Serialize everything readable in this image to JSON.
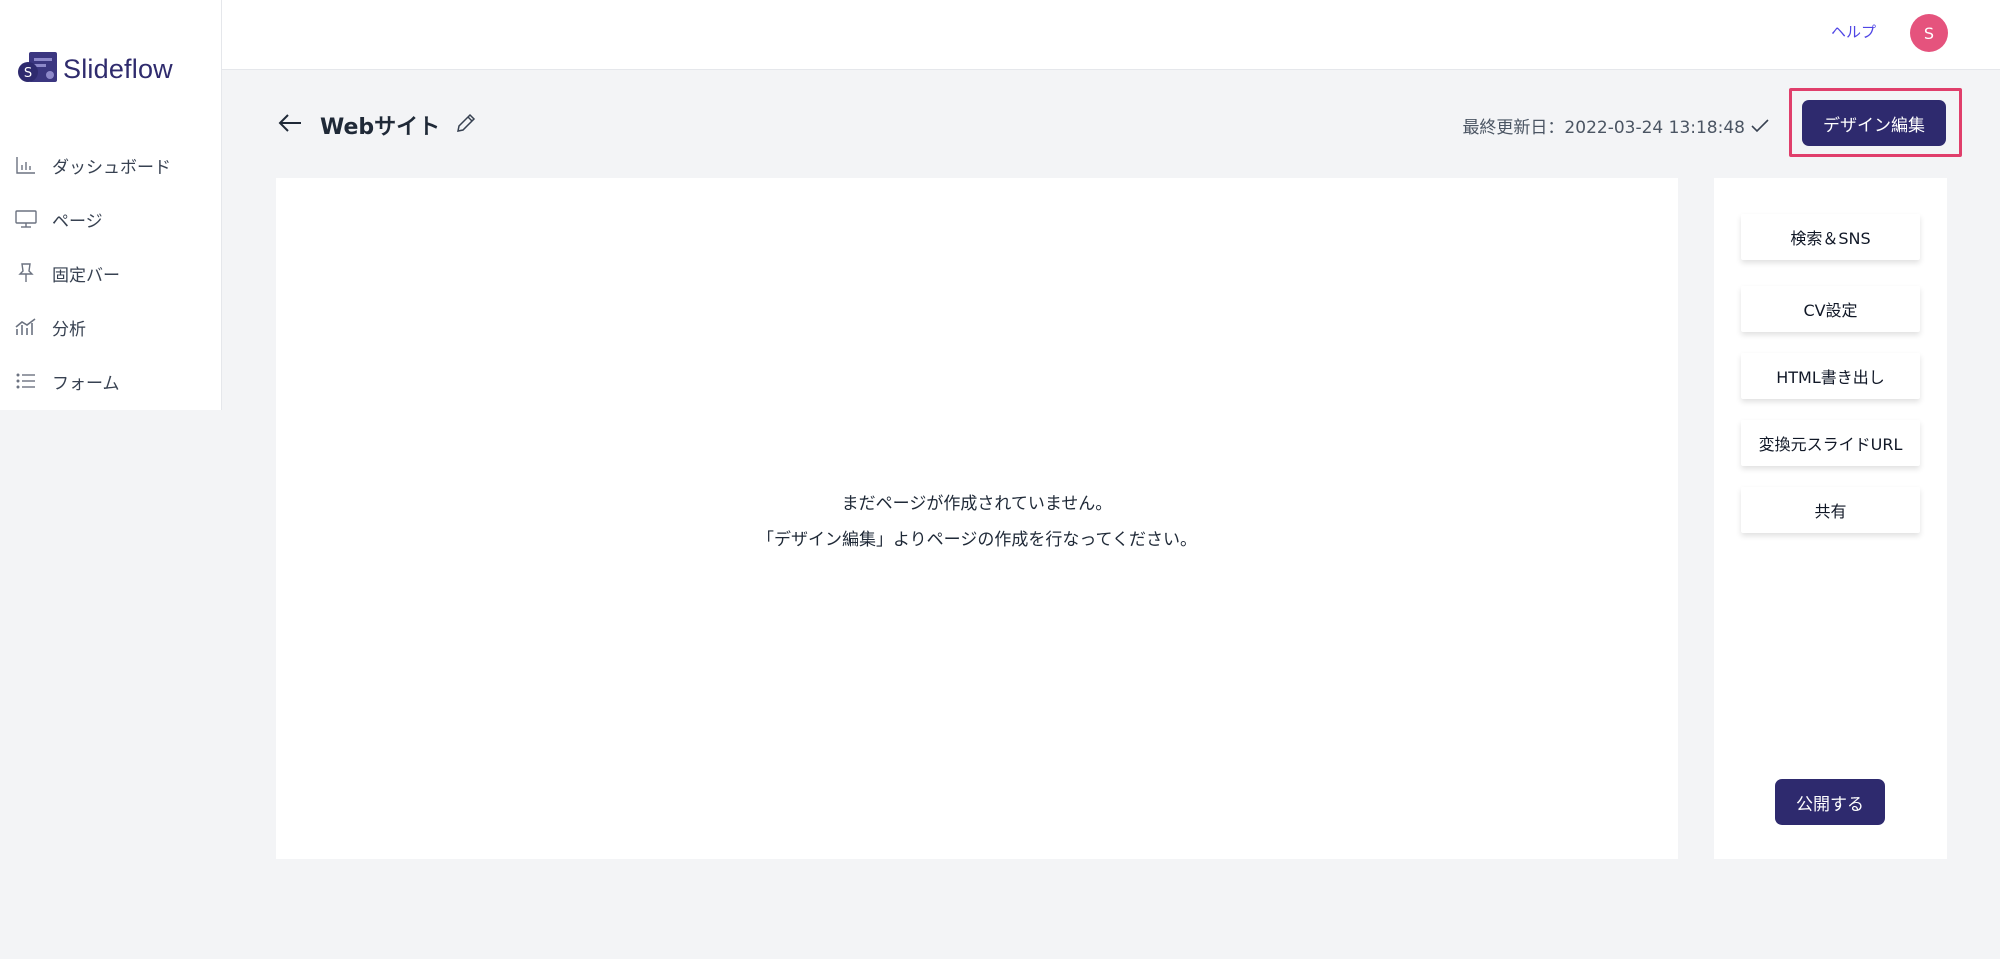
{
  "app": {
    "name": "Slideflow"
  },
  "topbar": {
    "help_label": "ヘルプ",
    "avatar_initial": "S"
  },
  "sidebar": {
    "items": [
      {
        "label": "ダッシュボード",
        "icon": "bar-chart-icon"
      },
      {
        "label": "ページ",
        "icon": "monitor-icon"
      },
      {
        "label": "固定バー",
        "icon": "pin-icon"
      },
      {
        "label": "分析",
        "icon": "analytics-icon"
      },
      {
        "label": "フォーム",
        "icon": "list-icon"
      }
    ]
  },
  "header": {
    "title": "Webサイト",
    "last_updated": "最終更新日：2022-03-24 13:18:48",
    "design_edit_label": "デザイン編集"
  },
  "main": {
    "empty_line1": "まだページが作成されていません。",
    "empty_line2": "「デザイン編集」よりページの作成を行なってください。"
  },
  "side_panel": {
    "buttons": [
      {
        "label": "検索＆SNS"
      },
      {
        "label": "CV設定"
      },
      {
        "label": "HTML書き出し"
      },
      {
        "label": "変換元スライドURL"
      },
      {
        "label": "共有"
      }
    ],
    "publish_label": "公開する"
  },
  "colors": {
    "brand": "#2e2a6e",
    "highlight": "#e03e6b",
    "avatar": "#e5537d",
    "link": "#4f46e5"
  }
}
